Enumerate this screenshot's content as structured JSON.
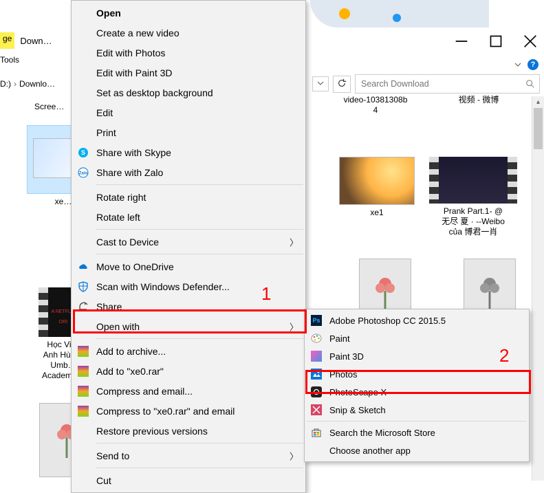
{
  "ribbon": {
    "yellow_tab": "ge",
    "tab_down": "Down…",
    "tools": "Tools"
  },
  "breadcrumb": {
    "drive": "D:)",
    "sep": "›",
    "folder": "Downlo…",
    "sub": "Scree…"
  },
  "files": {
    "selected": "xe…",
    "video1_line1": "video-10381308b",
    "video1_line2": "4",
    "video2": "视频 - 微博",
    "xe1": "xe1",
    "prank_l1": "Prank Part.1- @",
    "prank_l2": "无尽 夏 · --Weibo",
    "prank_l3": "của 博君一肖",
    "hocvien_l1": "Học Vi…",
    "hocvien_l2": "Anh Hùn…",
    "hocvien_l3": "Umb…",
    "hocvien_l4": "Academy…",
    "netflix_tag": "A NETFLIX ORI"
  },
  "search": {
    "placeholder": "Search Download"
  },
  "menu1": {
    "open": "Open",
    "create_video": "Create a new video",
    "edit_photos": "Edit with Photos",
    "edit_paint3d": "Edit with Paint 3D",
    "set_bg": "Set as desktop background",
    "edit": "Edit",
    "print": "Print",
    "share_skype": "Share with Skype",
    "share_zalo": "Share with Zalo",
    "rotate_r": "Rotate right",
    "rotate_l": "Rotate left",
    "cast": "Cast to Device",
    "onedrive": "Move to OneDrive",
    "defender": "Scan with Windows Defender...",
    "share": "Share",
    "open_with": "Open with",
    "add_archive": "Add to archive...",
    "add_xe0": "Add to \"xe0.rar\"",
    "comp_email": "Compress and email...",
    "comp_xe0_email": "Compress to \"xe0.rar\" and email",
    "restore": "Restore previous versions",
    "send_to": "Send to",
    "cut": "Cut"
  },
  "menu2": {
    "ps": "Adobe Photoshop CC 2015.5",
    "paint": "Paint",
    "paint3d": "Paint 3D",
    "photos": "Photos",
    "photoscape": "PhotoScape X",
    "snip": "Snip & Sketch",
    "search_store": "Search the Microsoft Store",
    "choose": "Choose another app"
  },
  "annotations": {
    "one": "1",
    "two": "2"
  }
}
